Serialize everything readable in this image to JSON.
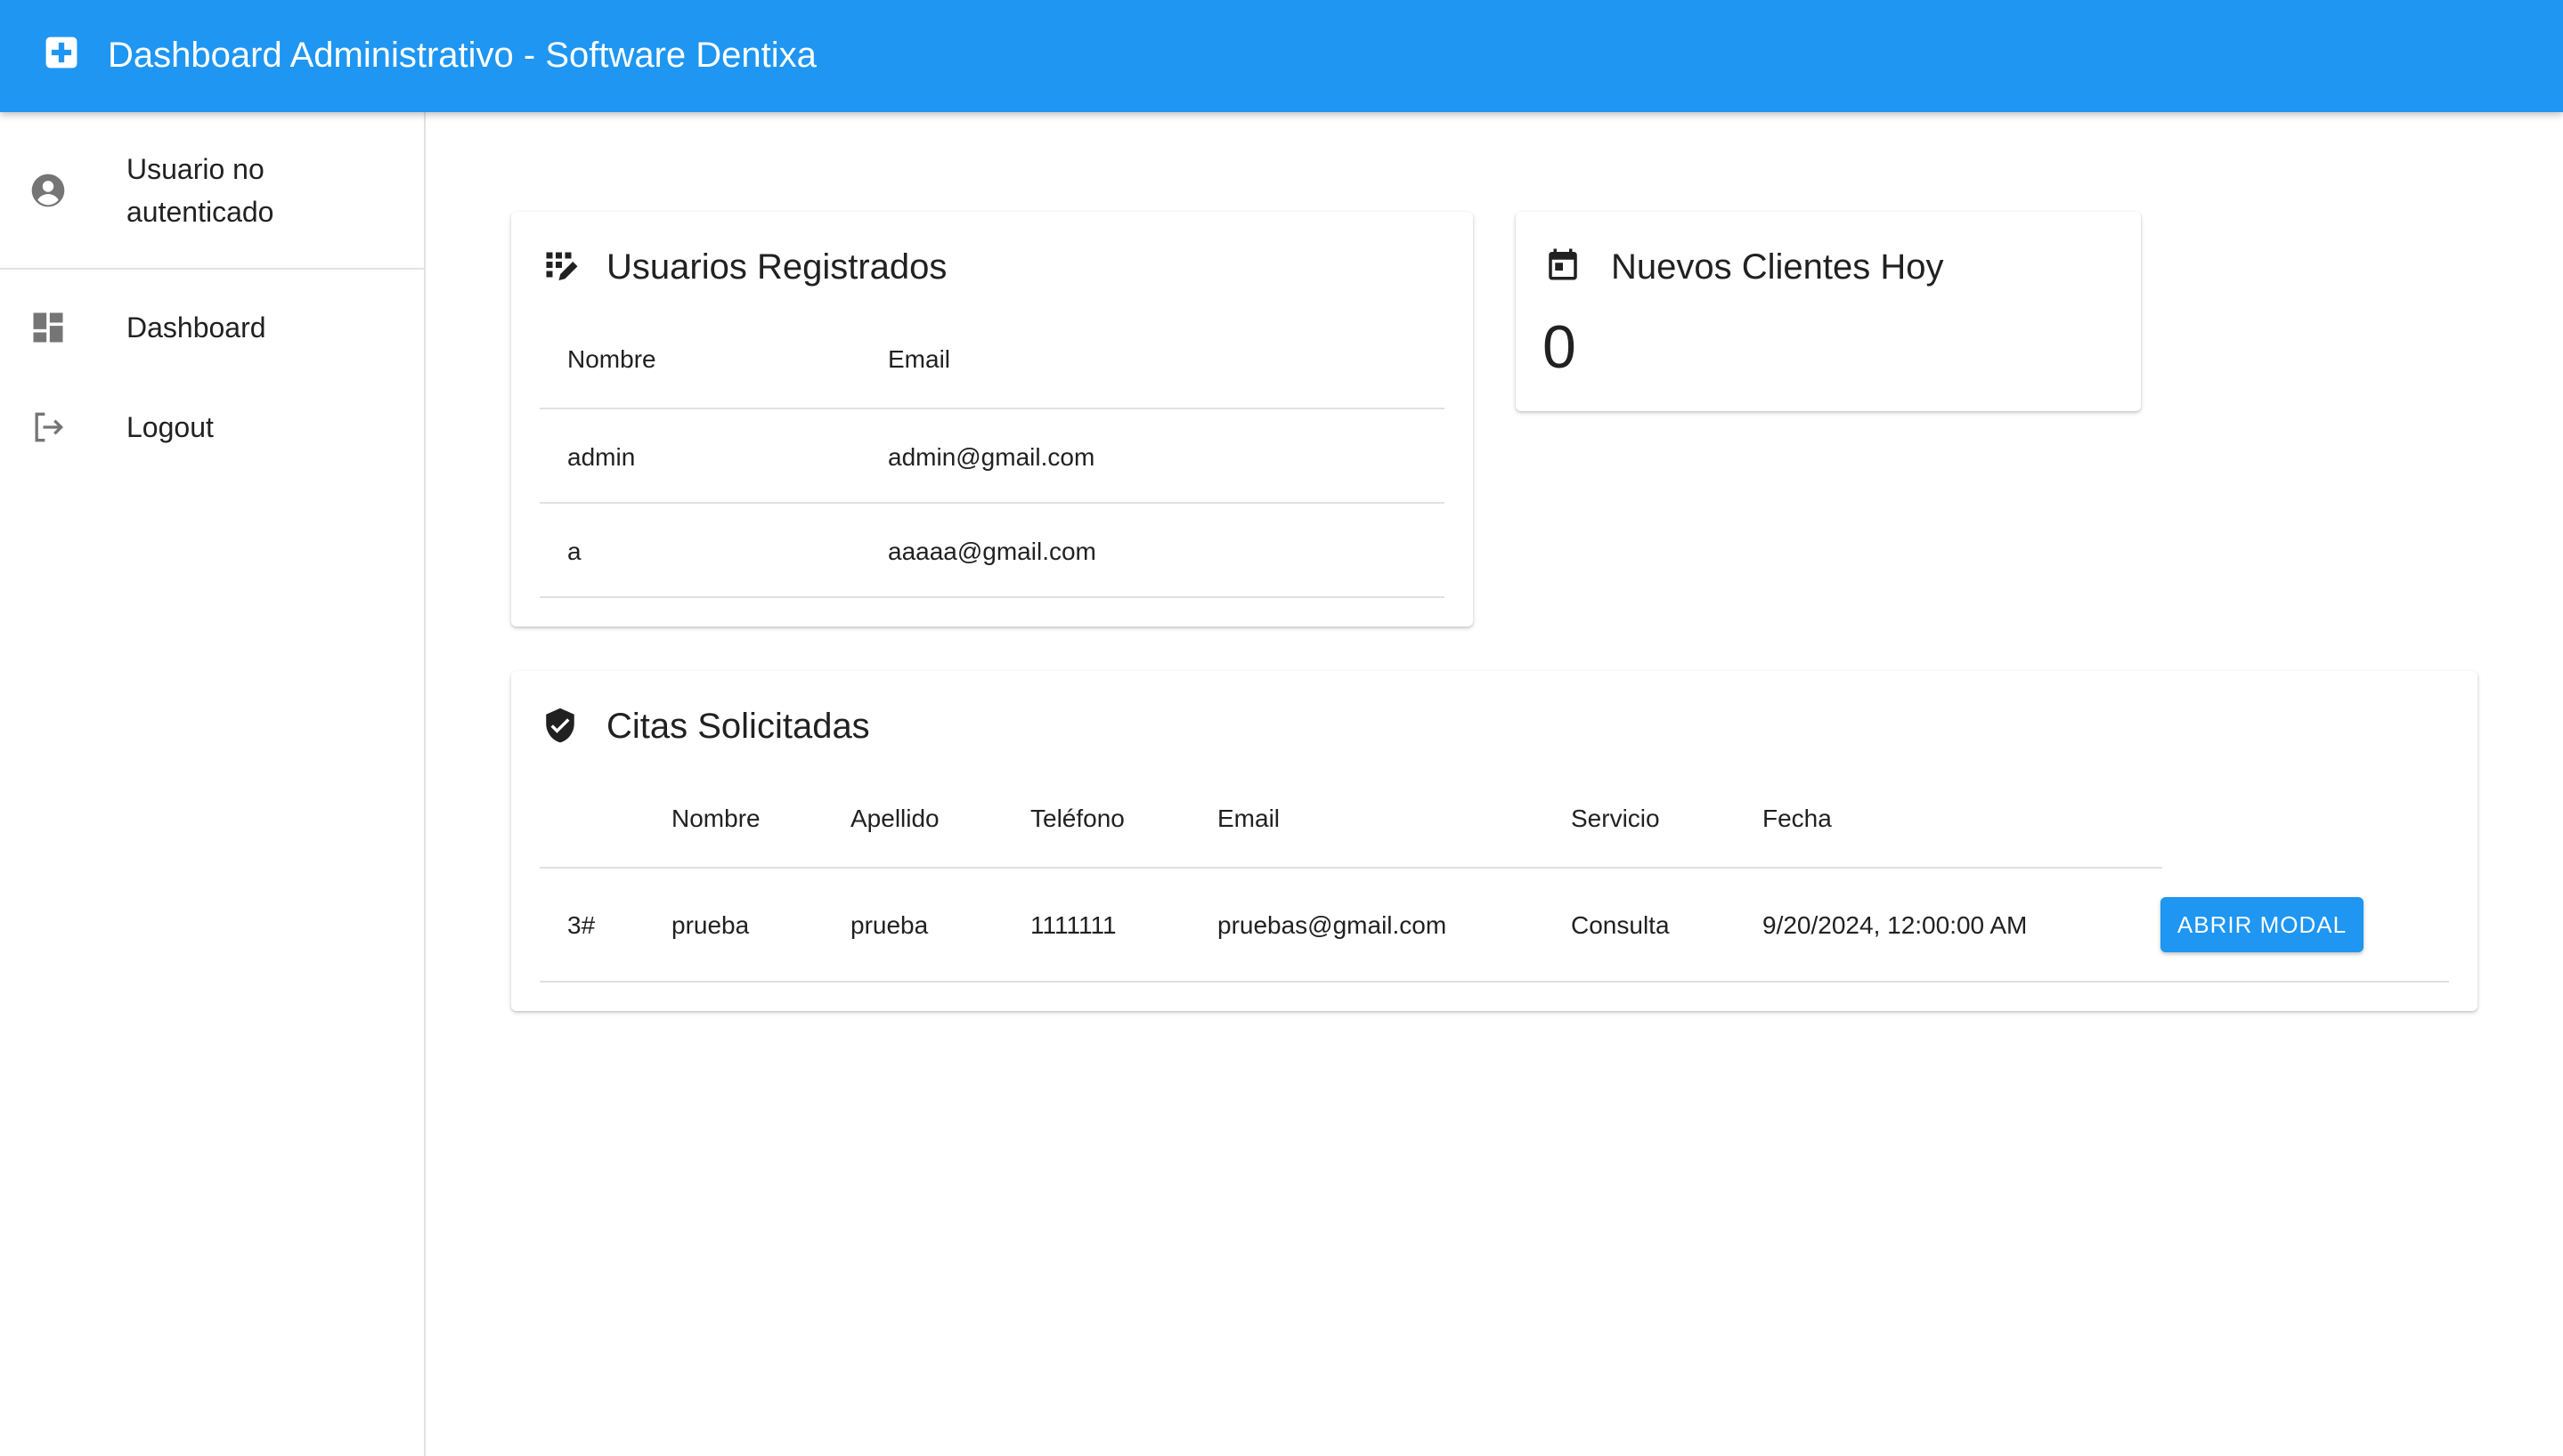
{
  "appbar": {
    "title": "Dashboard Administrativo - Software Dentixa",
    "logo_icon": "medical-plus-icon",
    "color": "#1e96f2"
  },
  "sidebar": {
    "user_label": "Usuario no autenticado",
    "user_icon": "account-circle-icon",
    "items": [
      {
        "label": "Dashboard",
        "icon": "dashboard-icon"
      },
      {
        "label": "Logout",
        "icon": "logout-icon"
      }
    ]
  },
  "users_card": {
    "title": "Usuarios Registrados",
    "icon": "grid-edit-icon",
    "columns": [
      "Nombre",
      "Email"
    ],
    "rows": [
      {
        "nombre": "admin",
        "email": "admin@gmail.com"
      },
      {
        "nombre": "a",
        "email": "aaaaa@gmail.com"
      }
    ]
  },
  "clients_card": {
    "title": "Nuevos Clientes Hoy",
    "icon": "calendar-icon",
    "count": "0"
  },
  "citas_card": {
    "title": "Citas Solicitadas",
    "icon": "verified-shield-icon",
    "columns": [
      "",
      "Nombre",
      "Apellido",
      "Teléfono",
      "Email",
      "Servicio",
      "Fecha"
    ],
    "rows": [
      {
        "id": "3#",
        "nombre": "prueba",
        "apellido": "prueba",
        "telefono": "1111111",
        "email": "pruebas@gmail.com",
        "servicio": "Consulta",
        "fecha": "9/20/2024, 12:00:00 AM",
        "action_label": "ABRIR MODAL"
      }
    ]
  }
}
